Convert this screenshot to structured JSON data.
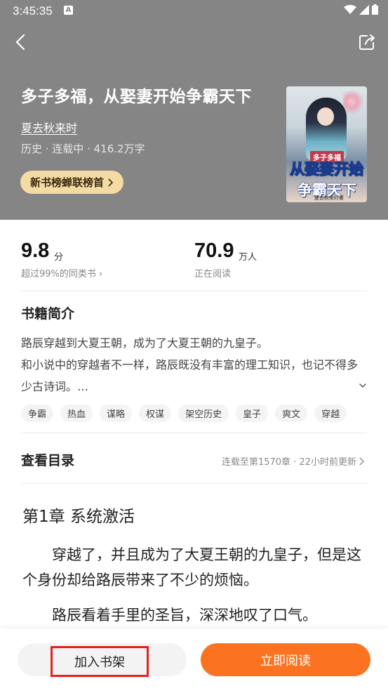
{
  "status_bar": {
    "time": "3:45:35",
    "notification_letter": "A"
  },
  "header": {
    "back_icon": "chevron-left-icon",
    "share_icon": "share-icon"
  },
  "book": {
    "title": "多子多福，从娶妻开始争霸天下",
    "author": "夏去秋来时",
    "meta": "历史 · 连载中 · 416.2万字",
    "rank_badge": "新书榜蝉联榜首",
    "cover": {
      "tag": "多子多福",
      "line1": "从娶妻开始",
      "line2": "争霸天下",
      "author_small": "夏去秋来时著"
    }
  },
  "stats": {
    "score": "9.8",
    "score_unit": "分",
    "score_sub": "超过99%的同类书",
    "readers": "70.9",
    "readers_unit": "万人",
    "readers_sub": "正在阅读"
  },
  "intro": {
    "title": "书籍简介",
    "line1": "路辰穿越到大夏王朝，成为了大夏王朝的九皇子。",
    "line2": "和小说中的穿越者不一样，路辰既没有丰富的理工知识，也记不得多少古诗词。…"
  },
  "tags": [
    "争霸",
    "热血",
    "谋略",
    "权谋",
    "架空历史",
    "皇子",
    "爽文",
    "穿越"
  ],
  "toc": {
    "title": "查看目录",
    "status": "连载至第1570章 · 22小时前更新"
  },
  "chapter": {
    "title": "第1章 系统激活",
    "para1": "穿越了，并且成为了大夏王朝的九皇子，但是这个身份却给路辰带来了不少的烦恼。",
    "para2": "路辰看着手里的圣旨，深深地叹了口气。"
  },
  "bottom": {
    "shelf_label": "加入书架",
    "read_label": "立即阅读"
  },
  "colors": {
    "hero_bg": "#858585",
    "badge_bg": "#f3dca4",
    "accent": "#fb7321",
    "highlight_box": "#e5201e"
  }
}
